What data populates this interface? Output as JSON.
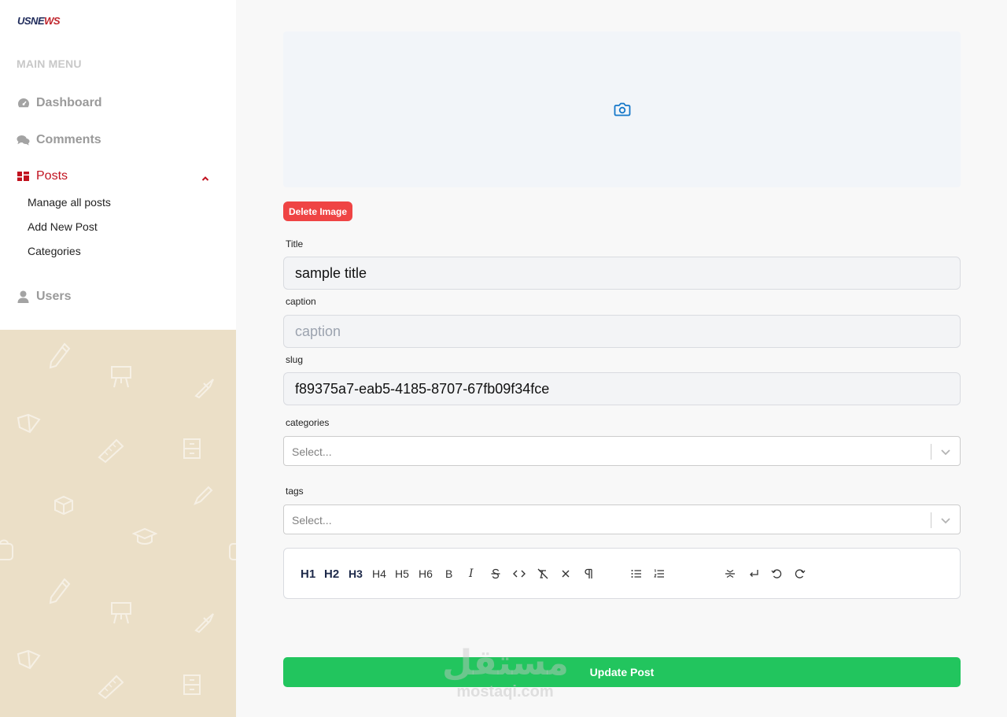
{
  "brand": {
    "logo_part1": "USNE",
    "logo_part2": "WS"
  },
  "sidebar": {
    "section_label": "MAIN MENU",
    "items": {
      "dashboard": "Dashboard",
      "comments": "Comments",
      "posts": "Posts",
      "users": "Users"
    },
    "posts_submenu": [
      "Manage all posts",
      "Add New Post",
      "Categories"
    ]
  },
  "form": {
    "delete_image_label": "Delete Image",
    "title": {
      "label": "Title",
      "value": "sample title"
    },
    "caption": {
      "label": "caption",
      "value": "",
      "placeholder": "caption"
    },
    "slug": {
      "label": "slug",
      "value": "f89375a7-eab5-4185-8707-67fb09f34fce"
    },
    "categories": {
      "label": "categories",
      "placeholder": "Select..."
    },
    "tags": {
      "label": "tags",
      "placeholder": "Select..."
    },
    "toolbar": {
      "h1": "H1",
      "h2": "H2",
      "h3": "H3",
      "h4": "H4",
      "h5": "H5",
      "h6": "H6",
      "bold": "B",
      "italic": "I"
    },
    "submit_label": "Update Post"
  },
  "watermark": {
    "arabic": "مستقل",
    "latin": "mostaqi.com"
  },
  "colors": {
    "accent_red": "#c1121f",
    "delete_red": "#ef4444",
    "submit_green": "#22c55e",
    "camera_blue": "#1477c9",
    "sidebar_pattern": "#ebdfc7"
  }
}
